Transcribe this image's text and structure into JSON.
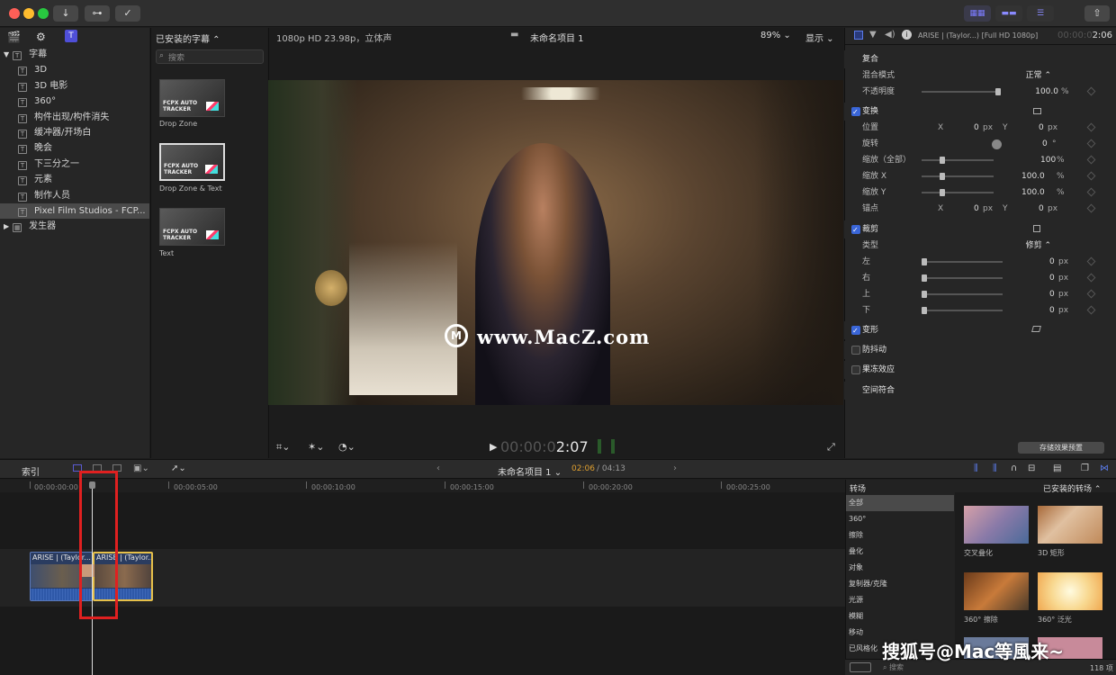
{
  "toolbar": {
    "download": "↓",
    "key": "⊶",
    "check": "✓",
    "share": "⇧"
  },
  "browser": {
    "header": "已安装的字幕 ⌃",
    "search_placeholder": "搜索",
    "tree": [
      {
        "label": "字幕",
        "icon": "T",
        "indent": 0,
        "arrow": "▼"
      },
      {
        "label": "3D",
        "icon": "T",
        "indent": 1
      },
      {
        "label": "3D 电影",
        "icon": "T",
        "indent": 1
      },
      {
        "label": "360°",
        "icon": "T",
        "indent": 1
      },
      {
        "label": "构件出现/构件消失",
        "icon": "T",
        "indent": 1
      },
      {
        "label": "缓冲器/开场白",
        "icon": "T",
        "indent": 1
      },
      {
        "label": "晚会",
        "icon": "T",
        "indent": 1
      },
      {
        "label": "下三分之一",
        "icon": "T",
        "indent": 1
      },
      {
        "label": "元素",
        "icon": "T",
        "indent": 1
      },
      {
        "label": "制作人员",
        "icon": "T",
        "indent": 1
      },
      {
        "label": "Pixel Film Studios - FCP...",
        "icon": "T",
        "indent": 1,
        "selected": true
      },
      {
        "label": "发生器",
        "icon": "▦",
        "indent": 0,
        "arrow": "▶"
      }
    ],
    "items": [
      {
        "thumb_text": "FCPX AUTO\nTRACKER",
        "label": "Drop Zone"
      },
      {
        "thumb_text": "FCPX AUTO\nTRACKER",
        "label": "Drop Zone & Text"
      },
      {
        "thumb_text": "FCPX AUTO\nTRACKER",
        "label": "Text"
      }
    ]
  },
  "viewer": {
    "format": "1080p HD 23.98p，立体声",
    "project": "未命名项目 1",
    "zoom": "89% ⌄",
    "display": "显示 ⌄",
    "watermark": "www.MacZ.com",
    "timecode_dim": "00:00:0",
    "timecode_bright": "2:07"
  },
  "inspector": {
    "clip_title": "ARISE | (Taylor...) [Full HD 1080p]",
    "time_dim": "00:00:0",
    "time": "2:06",
    "composite_header": "复合",
    "blend_label": "混合模式",
    "blend_value": "正常 ⌃",
    "opacity_label": "不透明度",
    "opacity_value": "100.0",
    "transform_header": "变换",
    "position_label": "位置",
    "rotation_label": "旋转",
    "scale_all_label": "缩放（全部）",
    "scale_x_label": "缩放 X",
    "scale_y_label": "缩放 Y",
    "anchor_label": "锚点",
    "crop_header": "裁剪",
    "type_label": "类型",
    "type_value": "修剪 ⌃",
    "left_label": "左",
    "right_label": "右",
    "top_label": "上",
    "bottom_label": "下",
    "distort_header": "变形",
    "stabilize_header": "防抖动",
    "rolling_header": "果冻效应",
    "spatial_header": "空间符合",
    "x": "X",
    "y": "Y",
    "v0": "0",
    "v100": "100",
    "v1000": "100.0",
    "px": "px",
    "pct": "%",
    "deg": "°",
    "save_preset": "存储效果预置"
  },
  "timeline": {
    "index": "索引",
    "project": "未命名项目 1 ⌄",
    "time_current": "02:06",
    "time_total": "/ 04:13",
    "ruler": [
      "00:00:00:00",
      "00:00:05:00",
      "00:00:10:00",
      "00:00:15:00",
      "00:00:20:00",
      "00:00:25:00"
    ],
    "clip1": "ARISE | (Taylor...",
    "clip2": "ARISE | (Taylor..."
  },
  "transitions": {
    "header": "转场",
    "installed": "已安装的转场 ⌃",
    "categories": [
      "全部",
      "360°",
      "擦除",
      "叠化",
      "对象",
      "复制器/克隆",
      "光源",
      "模糊",
      "移动",
      "已风格化"
    ],
    "items": [
      {
        "label": "交叉叠化"
      },
      {
        "label": "3D 矩形"
      },
      {
        "label": "360° 擦除"
      },
      {
        "label": "360° 泛光"
      }
    ],
    "search": "搜索",
    "count": "118 项"
  },
  "overlay_watermark": "搜狐号@Mac等風来~",
  "colors": {
    "accent": "#3a66d8",
    "highlight": "#e0a030",
    "red_box": "#e02020"
  }
}
